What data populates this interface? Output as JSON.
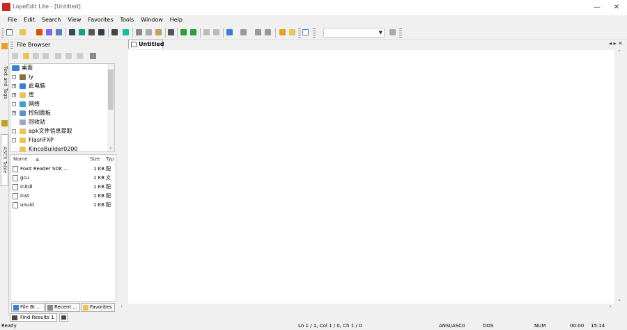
{
  "window": {
    "title": "LopeEdit Lite - [Untitled]",
    "minimize": "—",
    "maximize": "☐",
    "close": "✕"
  },
  "menu": [
    "File",
    "Edit",
    "Search",
    "View",
    "Favorites",
    "Tools",
    "Window",
    "Help"
  ],
  "left_vertical_tabs": [
    "Text and Tags",
    "ASCII Table"
  ],
  "file_browser": {
    "title": "File Browser",
    "tree": [
      {
        "label": "桌面",
        "expander": ""
      },
      {
        "label": "ly",
        "expander": "-"
      },
      {
        "label": "此电脑",
        "expander": "+"
      },
      {
        "label": "库",
        "expander": "+"
      },
      {
        "label": "网络",
        "expander": "-"
      },
      {
        "label": "控制面板",
        "expander": "+"
      },
      {
        "label": "回收站",
        "expander": ""
      },
      {
        "label": "apk文件信息提取",
        "expander": "-"
      },
      {
        "label": "FlashFXP",
        "expander": "-"
      },
      {
        "label": "KincoBuilder0200",
        "expander": ""
      }
    ],
    "columns": {
      "name": "Name",
      "size": "Size",
      "type": "Typ"
    },
    "files": [
      {
        "name": "Foxit Reader SDK ...",
        "size": "1 KB",
        "type": "配"
      },
      {
        "name": "gcu",
        "size": "1 KB",
        "type": "文"
      },
      {
        "name": "initdl",
        "size": "1 KB",
        "type": "配"
      },
      {
        "name": "inst",
        "size": "1 KB",
        "type": "配"
      },
      {
        "name": "unuid",
        "size": "1 KB",
        "type": "配"
      }
    ],
    "tabs": [
      "File Br...",
      "Recent ...",
      "Favorites"
    ]
  },
  "doc_tabs": [
    "Untitled"
  ],
  "doc_tab_controls": "◂ ▸ ✕",
  "find_results_tab": "Find Results 1",
  "search_combo": {
    "value": ""
  },
  "status": {
    "ready": "Ready",
    "position": "Ln 1 / 1, Col 1 / 0, Ch 1 / 0",
    "encoding": "ANSI/ASCII",
    "eol": "DOS",
    "num": "NUM",
    "time1": "00:00",
    "time2": "15:14"
  },
  "colors": {
    "accent_red": "#c62828",
    "folder": "#e8c45a",
    "monitor": "#3b7fd0",
    "green": "#2e9d3a"
  }
}
